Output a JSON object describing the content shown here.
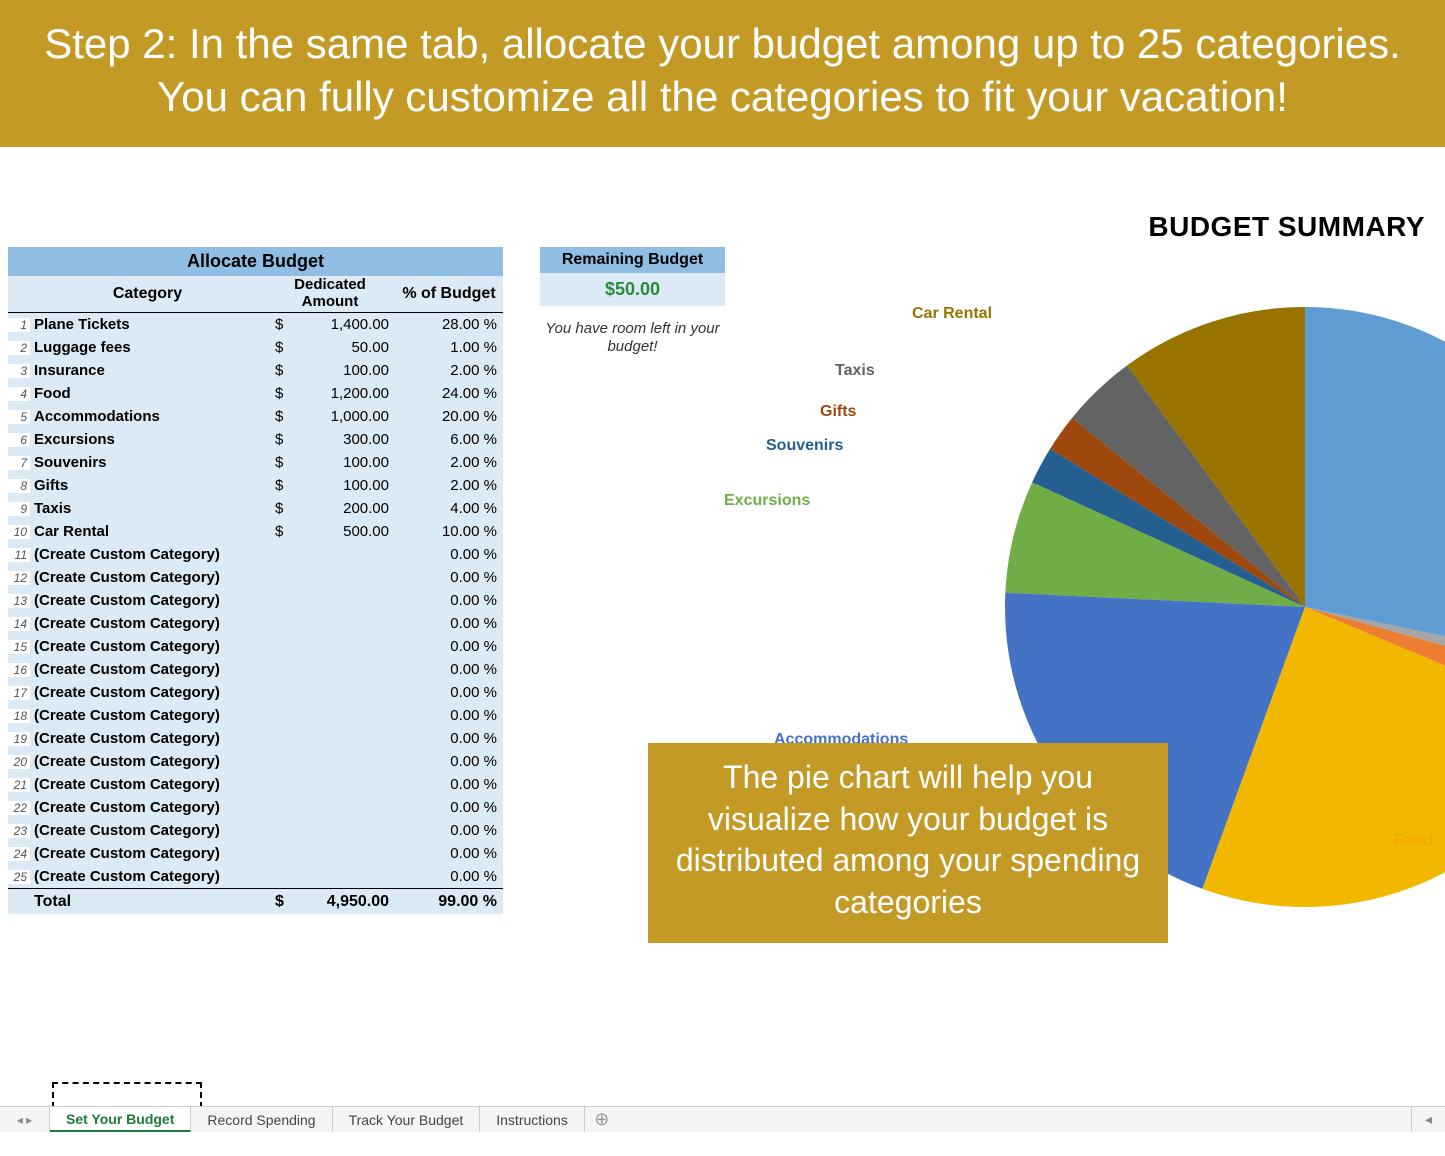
{
  "banner_text": "Step 2: In the same tab, allocate your budget among up to 25 categories. You can fully customize all the categories to fit your vacation!",
  "allocate": {
    "title": "Allocate Budget",
    "headers": {
      "category": "Category",
      "amount": "Dedicated Amount",
      "pct": "% of Budget"
    },
    "rows": [
      {
        "n": "1",
        "cat": "Plane Tickets",
        "amt": "1,400.00",
        "pct": "28.00 %"
      },
      {
        "n": "2",
        "cat": "Luggage fees",
        "amt": "50.00",
        "pct": "1.00 %"
      },
      {
        "n": "3",
        "cat": "Insurance",
        "amt": "100.00",
        "pct": "2.00 %"
      },
      {
        "n": "4",
        "cat": "Food",
        "amt": "1,200.00",
        "pct": "24.00 %"
      },
      {
        "n": "5",
        "cat": "Accommodations",
        "amt": "1,000.00",
        "pct": "20.00 %"
      },
      {
        "n": "6",
        "cat": "Excursions",
        "amt": "300.00",
        "pct": "6.00 %"
      },
      {
        "n": "7",
        "cat": "Souvenirs",
        "amt": "100.00",
        "pct": "2.00 %"
      },
      {
        "n": "8",
        "cat": "Gifts",
        "amt": "100.00",
        "pct": "2.00 %"
      },
      {
        "n": "9",
        "cat": "Taxis",
        "amt": "200.00",
        "pct": "4.00 %"
      },
      {
        "n": "10",
        "cat": "Car Rental",
        "amt": "500.00",
        "pct": "10.00 %"
      },
      {
        "n": "11",
        "cat": "(Create Custom Category)",
        "amt": "",
        "pct": "0.00 %"
      },
      {
        "n": "12",
        "cat": "(Create Custom Category)",
        "amt": "",
        "pct": "0.00 %"
      },
      {
        "n": "13",
        "cat": "(Create Custom Category)",
        "amt": "",
        "pct": "0.00 %"
      },
      {
        "n": "14",
        "cat": "(Create Custom Category)",
        "amt": "",
        "pct": "0.00 %"
      },
      {
        "n": "15",
        "cat": "(Create Custom Category)",
        "amt": "",
        "pct": "0.00 %"
      },
      {
        "n": "16",
        "cat": "(Create Custom Category)",
        "amt": "",
        "pct": "0.00 %"
      },
      {
        "n": "17",
        "cat": "(Create Custom Category)",
        "amt": "",
        "pct": "0.00 %"
      },
      {
        "n": "18",
        "cat": "(Create Custom Category)",
        "amt": "",
        "pct": "0.00 %"
      },
      {
        "n": "19",
        "cat": "(Create Custom Category)",
        "amt": "",
        "pct": "0.00 %"
      },
      {
        "n": "20",
        "cat": "(Create Custom Category)",
        "amt": "",
        "pct": "0.00 %"
      },
      {
        "n": "21",
        "cat": "(Create Custom Category)",
        "amt": "",
        "pct": "0.00 %"
      },
      {
        "n": "22",
        "cat": "(Create Custom Category)",
        "amt": "",
        "pct": "0.00 %"
      },
      {
        "n": "23",
        "cat": "(Create Custom Category)",
        "amt": "",
        "pct": "0.00 %"
      },
      {
        "n": "24",
        "cat": "(Create Custom Category)",
        "amt": "",
        "pct": "0.00 %"
      },
      {
        "n": "25",
        "cat": "(Create Custom Category)",
        "amt": "",
        "pct": "0.00 %"
      }
    ],
    "total": {
      "label": "Total",
      "amt": "4,950.00",
      "pct": "99.00 %"
    }
  },
  "remaining": {
    "title": "Remaining Budget",
    "value": "$50.00",
    "note": "You have room left in your budget!"
  },
  "summary_title": "BUDGET SUMMARY",
  "callout_text": "The pie chart will help you visualize how your budget is distributed among your spending categories",
  "tabs": {
    "active": "Set Your Budget",
    "items": [
      "Set Your Budget",
      "Record Spending",
      "Track Your Budget",
      "Instructions"
    ]
  },
  "chart_data": {
    "type": "pie",
    "title": "BUDGET SUMMARY",
    "slices": [
      {
        "label": "Plane Tickets",
        "value": 1400,
        "pct": 28.0,
        "color": "#5e9cd3"
      },
      {
        "label": "Luggage fees",
        "value": 50,
        "pct": 1.0,
        "color": "#a5a5a5"
      },
      {
        "label": "Insurance",
        "value": 100,
        "pct": 2.0,
        "color": "#ed7d31"
      },
      {
        "label": "Food",
        "value": 1200,
        "pct": 24.0,
        "color": "#f2b800"
      },
      {
        "label": "Accommodations",
        "value": 1000,
        "pct": 20.0,
        "color": "#4472c4"
      },
      {
        "label": "Excursions",
        "value": 300,
        "pct": 6.0,
        "color": "#70ad47"
      },
      {
        "label": "Souvenirs",
        "value": 100,
        "pct": 2.0,
        "color": "#255e91"
      },
      {
        "label": "Gifts",
        "value": 100,
        "pct": 2.0,
        "color": "#9e480e"
      },
      {
        "label": "Taxis",
        "value": 200,
        "pct": 4.0,
        "color": "#636363"
      },
      {
        "label": "Car Rental",
        "value": 500,
        "pct": 10.0,
        "color": "#997300"
      }
    ],
    "visible_labels": [
      "Car Rental",
      "Taxis",
      "Gifts",
      "Souvenirs",
      "Excursions",
      "Accommodations",
      "Food"
    ]
  }
}
